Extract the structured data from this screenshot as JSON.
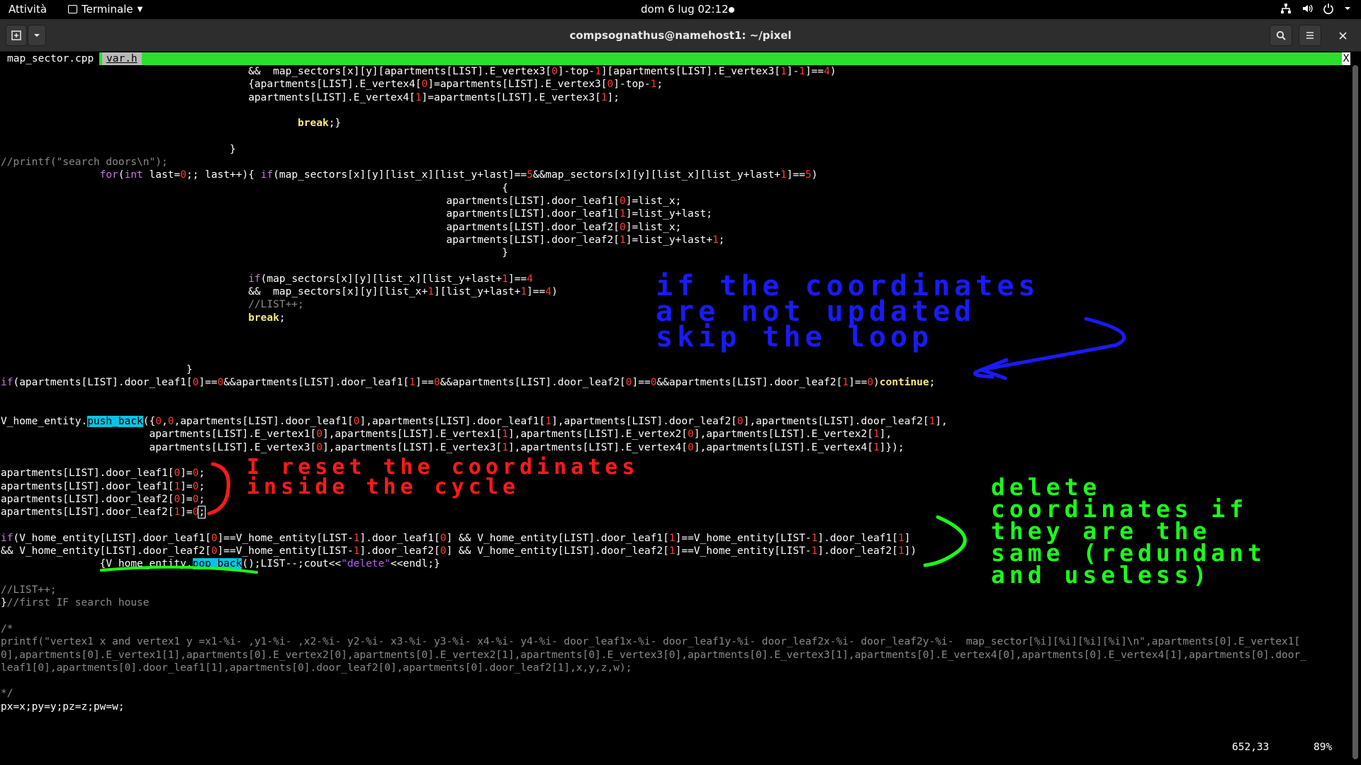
{
  "topbar": {
    "activities": "Attività",
    "app_menu": "Terminale",
    "clock": "dom 6 lug  02:12"
  },
  "window": {
    "title": "compsognathus@namehost1: ~/pixel"
  },
  "tabs": [
    {
      "label": "map_sector.cpp"
    },
    {
      "label": "var.h"
    }
  ],
  "tab_close": "X",
  "code_lines": [
    {
      "y": 0,
      "html": "                                        <span class='b'>&amp;&amp;  map_sectors[x][y][apartments[LIST].E_vertex3[</span><span class='n'>0</span><span class='b'>]-top-</span><span class='n'>1</span><span class='b'>][apartments[LIST].E_vertex3[</span><span class='n'>1</span><span class='b'>]-</span><span class='n'>1</span><span class='b'>]==</span><span class='n'>4</span><span class='b'>)</span>"
    },
    {
      "y": 1,
      "html": "                                        {apartments[LIST].E_vertex4[<span class='n'>0</span>]=apartments[LIST].E_vertex3[<span class='n'>0</span>]-top-<span class='n'>1</span>;"
    },
    {
      "y": 2,
      "html": "                                        apartments[LIST].E_vertex4[<span class='n'>1</span>]=apartments[LIST].E_vertex3[<span class='n'>1</span>];"
    },
    {
      "y": 4,
      "html": "                                                <span class='y'>break</span>;}"
    },
    {
      "y": 6,
      "html": "                                     }"
    },
    {
      "y": 7,
      "html": "<span class='c'>//printf(\"search doors\\n\");</span>"
    },
    {
      "y": 8,
      "html": "                <span class='k'>for</span>(<span class='k'>int</span> last=<span class='n'>0</span>;; last++){ <span class='k'>if</span>(map_sectors[x][y][list_x][list_y+last]==<span class='n'>5</span>&amp;&amp;map_sectors[x][y][list_x][list_y+last+<span class='n'>1</span>]==<span class='n'>5</span>)"
    },
    {
      "y": 9,
      "html": "                                                                                 {"
    },
    {
      "y": 10,
      "html": "                                                                        apartments[LIST].door_leaf1[<span class='n'>0</span>]=list_x;"
    },
    {
      "y": 11,
      "html": "                                                                        apartments[LIST].door_leaf1[<span class='n'>1</span>]=list_y+last;"
    },
    {
      "y": 12,
      "html": "                                                                        apartments[LIST].door_leaf2[<span class='n'>0</span>]=list_x;"
    },
    {
      "y": 13,
      "html": "                                                                        apartments[LIST].door_leaf2[<span class='n'>1</span>]=list_y+last+<span class='n'>1</span>;"
    },
    {
      "y": 14,
      "html": "                                                                                 }"
    },
    {
      "y": 16,
      "html": "                                        <span class='k'>if</span>(map_sectors[x][y][list_x][list_y+last+<span class='n'>1</span>]==<span class='n'>4</span>"
    },
    {
      "y": 17,
      "html": "                                        &amp;&amp;  map_sectors[x][y][list_x+<span class='n'>1</span>][list_y+last+<span class='n'>1</span>]==<span class='n'>4</span>)"
    },
    {
      "y": 18,
      "html": "                                        <span class='c'>//LIST++;</span>"
    },
    {
      "y": 19,
      "html": "                                        <span class='y'>break</span>;"
    },
    {
      "y": 23,
      "html": "                              }"
    },
    {
      "y": 24,
      "html": "<span class='k'>if</span>(apartments[LIST].door_leaf1[<span class='n'>0</span>]==<span class='n'>0</span>&amp;&amp;apartments[LIST].door_leaf1[<span class='n'>1</span>]==<span class='n'>0</span>&amp;&amp;apartments[LIST].door_leaf2[<span class='n'>0</span>]==<span class='n'>0</span>&amp;&amp;apartments[LIST].door_leaf2[<span class='n'>1</span>]==<span class='n'>0</span>)<span class='y'>continue</span>;"
    },
    {
      "y": 27,
      "html": "V_home_entity.<span class='hl'>push_back</span>({<span class='n'>0</span>,<span class='n'>0</span>,apartments[LIST].door_leaf1[<span class='n'>0</span>],apartments[LIST].door_leaf1[<span class='n'>1</span>],apartments[LIST].door_leaf2[<span class='n'>0</span>],apartments[LIST].door_leaf2[<span class='n'>1</span>],"
    },
    {
      "y": 28,
      "html": "                        apartments[LIST].E_vertex1[<span class='n'>0</span>],apartments[LIST].E_vertex1[<span class='n'>1</span>],apartments[LIST].E_vertex2[<span class='n'>0</span>],apartments[LIST].E_vertex2[<span class='n'>1</span>],"
    },
    {
      "y": 29,
      "html": "                        apartments[LIST].E_vertex3[<span class='n'>0</span>],apartments[LIST].E_vertex3[<span class='n'>1</span>],apartments[LIST].E_vertex4[<span class='n'>0</span>],apartments[LIST].E_vertex4[<span class='n'>1</span>]});"
    },
    {
      "y": 31,
      "html": "apartments[LIST].door_leaf1[<span class='n'>0</span>]=<span class='n'>0</span>;"
    },
    {
      "y": 32,
      "html": "apartments[LIST].door_leaf1[<span class='n'>1</span>]=<span class='n'>0</span>;"
    },
    {
      "y": 33,
      "html": "apartments[LIST].door_leaf2[<span class='n'>0</span>]=<span class='n'>0</span>;"
    },
    {
      "y": 34,
      "html": "apartments[LIST].door_leaf2[<span class='n'>1</span>]=<span class='n'>0</span><span class='cur'>;</span>"
    },
    {
      "y": 36,
      "html": "<span class='k'>if</span>(V_home_entity[LIST].door_leaf1[<span class='n'>0</span>]==V_home_entity[LIST-<span class='n'>1</span>].door_leaf1[<span class='n'>0</span>] &amp;&amp; V_home_entity[LIST].door_leaf1[<span class='n'>1</span>]==V_home_entity[LIST-<span class='n'>1</span>].door_leaf1[<span class='n'>1</span>]"
    },
    {
      "y": 37,
      "html": "&amp;&amp; V_home_entity[LIST].door_leaf2[<span class='n'>0</span>]==V_home_entity[LIST-<span class='n'>1</span>].door_leaf2[<span class='n'>0</span>] &amp;&amp; V_home_entity[LIST].door_leaf2[<span class='n'>1</span>]==V_home_entity[LIST-<span class='n'>1</span>].door_leaf2[<span class='n'>1</span>])"
    },
    {
      "y": 38,
      "html": "                {V_home_entity.<span class='hl'>pop_back</span>();LIST--;cout&lt;&lt;<span class='s'>\"delete\"</span>&lt;&lt;endl;}"
    },
    {
      "y": 40,
      "html": "<span class='c'>//LIST++;</span>"
    },
    {
      "y": 41,
      "html": "}<span class='c'>//first IF search house</span>"
    },
    {
      "y": 43,
      "html": "<span class='c'>/*</span>"
    },
    {
      "y": 44,
      "html": "<span class='c'>printf(\"vertex1 x and vertex1 y =x1-%i- ,y1-%i- ,x2-%i- y2-%i- x3-%i- y3-%i- x4-%i- y4-%i- door_leaf1x-%i- door_leaf1y-%i- door_leaf2x-%i- door_leaf2y-%i-  map_sector[%i][%i][%i][%i]\\n\",apartments[0].E_vertex1[</span>"
    },
    {
      "y": 45,
      "html": "<span class='c'>0],apartments[0].E_vertex1[1],apartments[0].E_vertex2[0],apartments[0].E_vertex2[1],apartments[0].E_vertex3[0],apartments[0].E_vertex3[1],apartments[0].E_vertex4[0],apartments[0].E_vertex4[1],apartments[0].door_</span>"
    },
    {
      "y": 46,
      "html": "<span class='c'>leaf1[0],apartments[0].door_leaf1[1],apartments[0].door_leaf2[0],apartments[0].door_leaf2[1],x,y,z,w);</span>"
    },
    {
      "y": 48,
      "html": "<span class='c'>*/</span>"
    },
    {
      "y": 49,
      "html": "px=x;py=y;pz=z;pw=w;"
    }
  ],
  "status": {
    "position": "652,33",
    "percent": "89%"
  },
  "annotations": {
    "blue": "if the coordinates\nare not updated\nskip the loop",
    "red": "I reset the coordinates\ninside the cycle",
    "green": "delete\ncoordinates if\nthey are the\nsame (redundant\nand useless)"
  }
}
